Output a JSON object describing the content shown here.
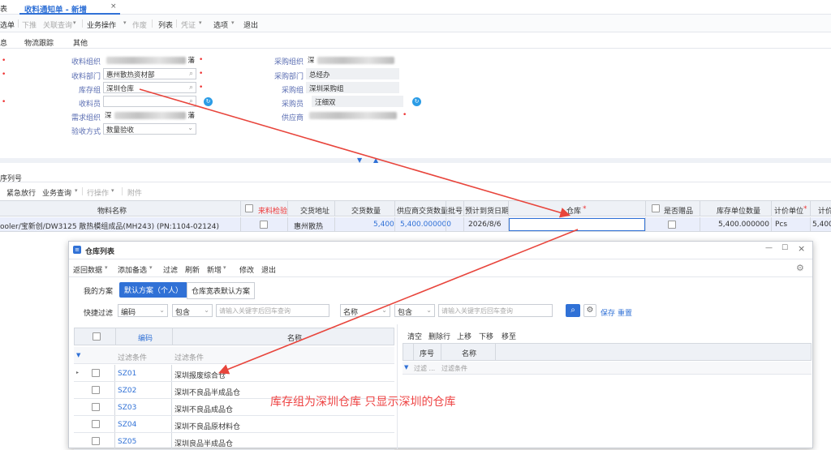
{
  "tabs": {
    "home_fragment": "表",
    "active": "收料通知单 - 新增",
    "close": "×"
  },
  "toolbar": {
    "items": [
      "选单",
      "下推",
      "关联查询",
      "业务操作",
      "作废",
      "列表",
      "凭证",
      "选项",
      "退出"
    ]
  },
  "subtabs": [
    "息",
    "物流跟踪",
    "其他"
  ],
  "form": {
    "recv_org_label": "收料组织",
    "recv_org_value": "藩",
    "recv_dept_label": "收料部门",
    "recv_dept_value": "惠州散热资材部",
    "stock_group_label": "库存组",
    "stock_group_value": "深圳仓库",
    "receiver_label": "收料员",
    "receiver_value": "",
    "demand_org_label": "需求组织",
    "demand_org_value_start": "深",
    "demand_org_value_end": "藩",
    "check_method_label": "验收方式",
    "check_method_value": "数量验收",
    "purch_org_label": "采购组织",
    "purch_org_value": "深",
    "purch_dept_label": "采购部门",
    "purch_dept_value": "总经办",
    "purch_group_label": "采购组",
    "purch_group_value": "深圳采购组",
    "purchaser_label": "采购员",
    "purchaser_value": "汪细双",
    "supplier_label": "供应商"
  },
  "detail": {
    "section_title": "序列号",
    "toolbar": [
      "紧急放行",
      "业务查询",
      "行操作",
      "附件"
    ],
    "headers": [
      "物料名称",
      "来料检验",
      "交货地址",
      "交货数量",
      "供应商交货数量",
      "批号",
      "预计到货日期",
      "仓库",
      "是否赠品",
      "库存单位数量",
      "计价单位",
      "计价"
    ],
    "row": {
      "material": "ooler/宝新创/DW3125 散热模组成品(MH243) (PN:1104-02124)",
      "address": "惠州散热",
      "qty": "5,400",
      "sup_qty": "5,400.000000",
      "date": "2026/8/6",
      "stock_qty": "5,400.000000",
      "unit": "Pcs",
      "price_fragment": "5,400."
    }
  },
  "dialog": {
    "title": "仓库列表",
    "toolbar": [
      "返回数据",
      "添加备选",
      "过滤",
      "刷新",
      "新增",
      "修改",
      "退出"
    ],
    "my_scheme": "我的方案",
    "default_scheme": "默认方案（个人）",
    "scheme_btn": "仓库宽表默认方案",
    "quick_filter": "快捷过滤",
    "f1_field": "编码",
    "f1_op": "包含",
    "f1_ph": "请输入关键字后回车查询",
    "f2_field": "名称",
    "f2_op": "包含",
    "f2_ph": "请输入关键字后回车查询",
    "save": "保存",
    "reset": "重置",
    "col_code": "编码",
    "col_name": "名称",
    "filter_row": "过滤条件",
    "rows": [
      {
        "code": "SZ01",
        "name": "深圳报废综合仓"
      },
      {
        "code": "SZ02",
        "name": "深圳不良品半成品仓"
      },
      {
        "code": "SZ03",
        "name": "深圳不良品成品仓"
      },
      {
        "code": "SZ04",
        "name": "深圳不良品原材料仓"
      },
      {
        "code": "SZ05",
        "name": "深圳良品半成品仓"
      }
    ],
    "right_toolbar": [
      "清空",
      "删除行",
      "上移",
      "下移",
      "移至"
    ],
    "right_col_no": "序号",
    "right_col_name": "名称",
    "right_filter1": "过滤 ...",
    "right_filter2": "过滤条件"
  },
  "annotation": "库存组为深圳仓库  只显示深圳的仓库",
  "colors": {
    "accent": "#3071d6",
    "arrow": "#e8453c",
    "note": "#e44444"
  }
}
